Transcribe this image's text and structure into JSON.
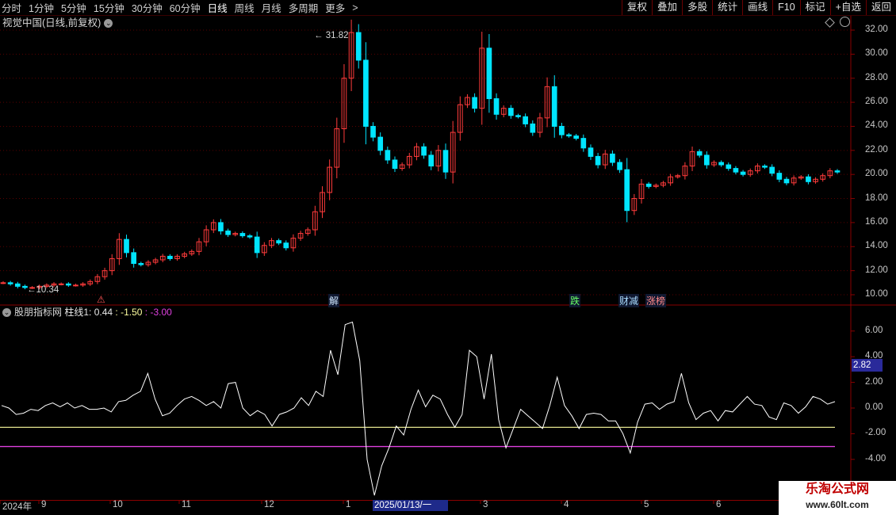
{
  "toolbar": {
    "periods": [
      "分时",
      "1分钟",
      "5分钟",
      "15分钟",
      "30分钟",
      "60分钟",
      "日线",
      "周线",
      "月线",
      "多周期",
      "更多"
    ],
    "active_period": "日线",
    "more_arrow": ">",
    "actions": [
      "复权",
      "叠加",
      "多股",
      "统计",
      "画线",
      "F10",
      "标记",
      "+自选",
      "返回"
    ]
  },
  "main_chart": {
    "title": "视觉中国(日线,前复权)",
    "high_label": "31.82",
    "low_label": "10.34",
    "y_ticks": [
      "32.00",
      "30.00",
      "28.00",
      "26.00",
      "24.00",
      "22.00",
      "20.00",
      "18.00",
      "16.00",
      "14.00",
      "12.00",
      "10.00"
    ],
    "events": [
      {
        "label": "⚠",
        "color": "#ff5555"
      },
      {
        "label": "解",
        "color": "#cfe7ff"
      },
      {
        "label": "跌",
        "color": "#66ff66"
      },
      {
        "label": "财减",
        "color": "#aaddff"
      },
      {
        "label": "涨榜",
        "color": "#ff8888"
      }
    ]
  },
  "indicator": {
    "name": "股朋指标网",
    "line1": "柱线1: 0.44",
    "line2": ": -1.50",
    "line3": ": -3.00",
    "y_ticks": [
      "6.00",
      "4.00",
      "2.00",
      "0.00",
      "-2.00",
      "-4.00"
    ],
    "current_value": "2.82"
  },
  "x_axis": {
    "labels": [
      "2024年",
      "9",
      "10",
      "11",
      "12",
      "1",
      "2025/01/13/一",
      "3",
      "4",
      "5",
      "6"
    ]
  },
  "watermark": {
    "line1": "乐淘公式网",
    "line2": "www.60lt.com"
  },
  "colors": {
    "up": "#ff3b3b",
    "down": "#00e5ff",
    "line_white": "#ffffff",
    "line_yellow": "#ffffa0",
    "line_magenta": "#e040e0",
    "grid": "#8a0000"
  },
  "chart_data": {
    "type": "candlestick",
    "price_ylim": [
      9.5,
      32.5
    ],
    "close_path": [
      11.0,
      10.9,
      10.7,
      10.6,
      10.6,
      10.7,
      10.8,
      10.9,
      10.9,
      10.8,
      10.8,
      10.9,
      11.1,
      11.5,
      12.0,
      13.0,
      14.6,
      13.5,
      12.6,
      12.5,
      12.7,
      12.9,
      13.2,
      13.0,
      13.2,
      13.4,
      13.6,
      14.4,
      15.4,
      16.0,
      15.3,
      15.0,
      15.1,
      14.9,
      14.8,
      13.5,
      14.1,
      14.5,
      14.3,
      13.9,
      14.7,
      15.1,
      15.4,
      16.9,
      18.5,
      20.6,
      23.8,
      28.0,
      31.8,
      29.5,
      24.0,
      23.1,
      22.0,
      21.2,
      20.5,
      20.8,
      21.5,
      22.3,
      21.6,
      20.7,
      22.0,
      20.2,
      23.5,
      25.8,
      26.4,
      25.5,
      30.5,
      26.3,
      25.0,
      25.5,
      24.9,
      24.8,
      24.2,
      23.5,
      24.7,
      27.3,
      24.0,
      23.3,
      23.2,
      23.0,
      22.2,
      21.5,
      20.8,
      21.7,
      21.0,
      20.4,
      17.0,
      18.0,
      19.2,
      19.0,
      19.1,
      19.3,
      19.8,
      19.9,
      20.7,
      21.9,
      21.6,
      20.8,
      21.0,
      20.8,
      20.5,
      20.2,
      20.0,
      20.3,
      20.7,
      20.6,
      20.1,
      19.6,
      19.3,
      19.7,
      19.8,
      19.4,
      19.6,
      19.9,
      20.3,
      20.2
    ]
  },
  "indicator_data": {
    "ylim": [
      -7.0,
      8.0
    ],
    "hline_yellow": -1.5,
    "hline_magenta": -3.0,
    "values": [
      0.2,
      0.0,
      -0.5,
      -0.4,
      -0.1,
      -0.2,
      0.2,
      0.4,
      0.1,
      0.4,
      0.0,
      0.2,
      -0.1,
      -0.1,
      0.0,
      -0.3,
      0.5,
      0.6,
      1.0,
      1.3,
      2.7,
      0.7,
      -0.6,
      -0.4,
      0.2,
      0.7,
      0.9,
      0.6,
      0.2,
      0.5,
      0.0,
      1.9,
      2.0,
      0.0,
      -0.6,
      -0.2,
      -0.5,
      -1.4,
      -0.5,
      -0.3,
      0.0,
      0.8,
      0.2,
      1.3,
      0.9,
      4.5,
      2.6,
      6.5,
      6.7,
      3.7,
      -4.0,
      -6.8,
      -4.5,
      -3.1,
      -1.4,
      -2.1,
      -0.1,
      1.4,
      0.1,
      1.0,
      0.7,
      -0.5,
      -1.5,
      -0.5,
      4.5,
      4.0,
      0.7,
      4.2,
      -0.9,
      -3.1,
      -1.6,
      -0.1,
      -0.6,
      -1.1,
      -1.6,
      0.2,
      2.4,
      0.2,
      -0.6,
      -1.6,
      -0.5,
      -0.4,
      -0.5,
      -1.0,
      -1.0,
      -2.0,
      -3.5,
      -1.1,
      0.3,
      0.4,
      -0.1,
      0.3,
      0.5,
      2.7,
      0.4,
      -0.9,
      -0.4,
      -0.2,
      -1.0,
      -0.2,
      -0.3,
      0.3,
      0.9,
      0.3,
      0.2,
      -0.7,
      -0.9,
      0.4,
      0.2,
      -0.4,
      0.1,
      0.9,
      0.7,
      0.3,
      0.5
    ]
  }
}
